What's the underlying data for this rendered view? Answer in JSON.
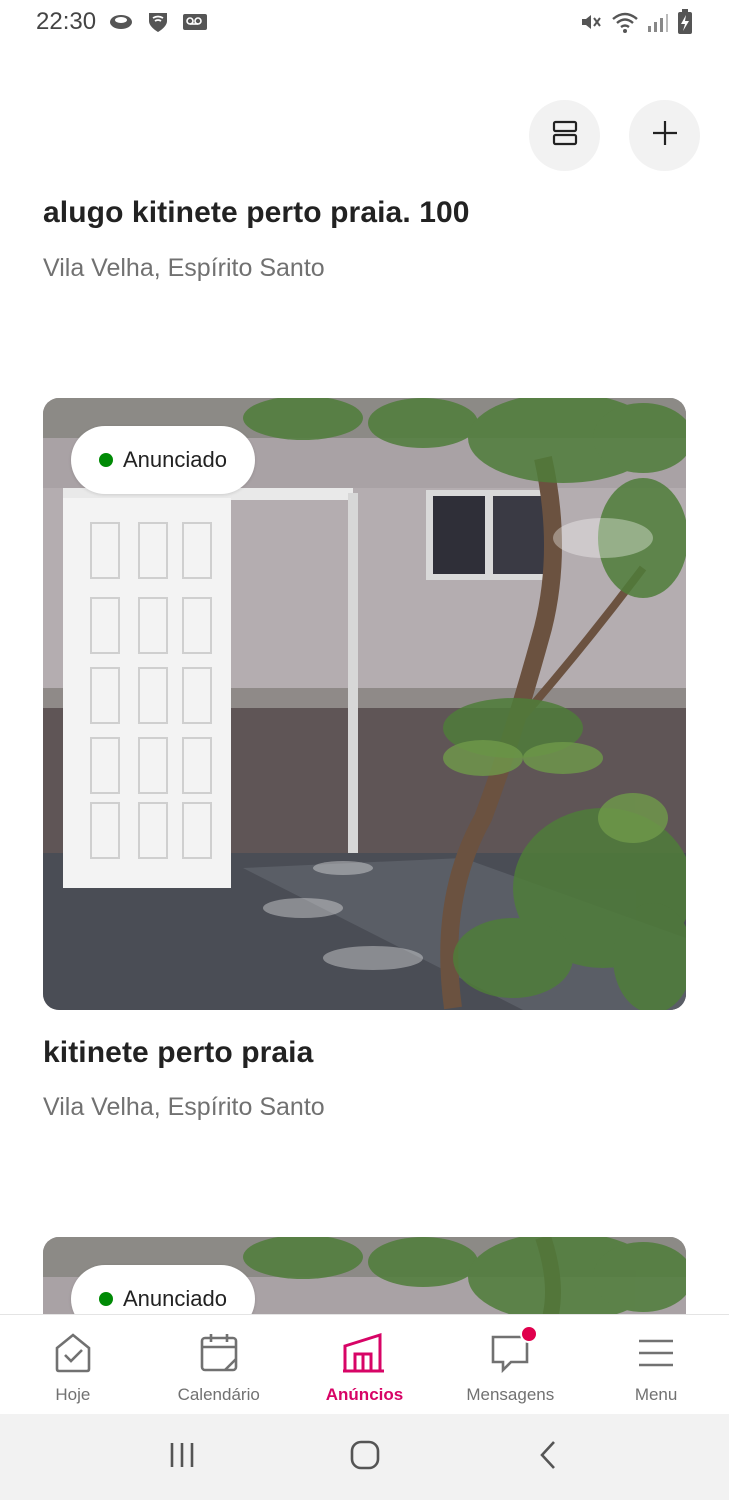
{
  "status_bar": {
    "time": "22:30",
    "icons_left": [
      "cloud-icon",
      "shield-wifi-icon",
      "voicemail-icon"
    ],
    "icons_right": [
      "mute-icon",
      "wifi-icon",
      "signal-icon",
      "battery-charging-icon"
    ]
  },
  "toolbar": {
    "layout_toggle_icon": "view-list-icon",
    "add_icon": "plus-icon"
  },
  "listings": [
    {
      "title": "alugo kitinete perto praia. 100",
      "location": "Vila Velha, Espírito Santo"
    },
    {
      "title": "kitinete perto praia",
      "location": "Vila Velha, Espírito Santo",
      "status": "Anunciado",
      "status_color": "#008a05"
    },
    {
      "status": "Anunciado",
      "status_color": "#008a05"
    }
  ],
  "bottom_nav": {
    "items": [
      {
        "label": "Hoje",
        "icon": "today-check-icon"
      },
      {
        "label": "Calendário",
        "icon": "calendar-icon"
      },
      {
        "label": "Anúncios",
        "icon": "listings-house-icon",
        "active": true
      },
      {
        "label": "Mensagens",
        "icon": "message-icon",
        "has_notification": true
      },
      {
        "label": "Menu",
        "icon": "menu-icon"
      }
    ],
    "active_color": "#d70466"
  },
  "system_nav": {
    "buttons": [
      "recent-apps-icon",
      "home-icon",
      "back-icon"
    ]
  }
}
